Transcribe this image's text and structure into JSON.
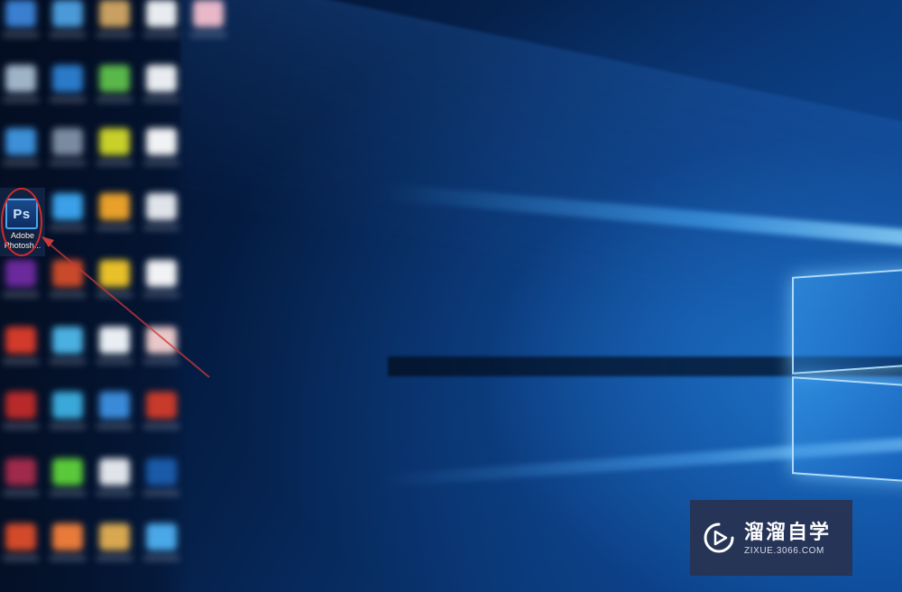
{
  "desktop": {
    "highlighted_shortcut": {
      "icon_text": "Ps",
      "label_line1": "Adobe",
      "label_line2": "Photosh..."
    }
  },
  "watermark": {
    "name": "溜溜自学",
    "url": "ZIXUE.3066.COM"
  },
  "colors": {
    "highlight_ring": "#d22a2a",
    "ps_accent": "#4ea4ef",
    "watermark_bg": "#283250"
  }
}
